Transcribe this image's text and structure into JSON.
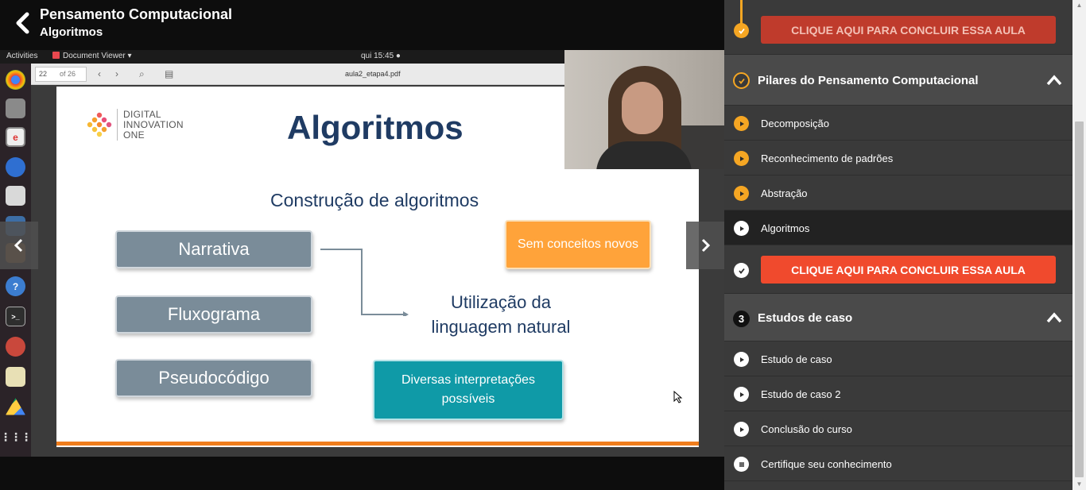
{
  "header": {
    "course_title": "Pensamento Computacional",
    "lesson_title": "Algoritmos"
  },
  "ubuntu": {
    "activities": "Activities",
    "app_name": "Document Viewer ▾",
    "clock": "qui 15:45 ●"
  },
  "pdf": {
    "current_page": "22",
    "page_total": "of 26",
    "file_name": "aula2_etapa4.pdf"
  },
  "slide": {
    "logo_line1": "DIGITAL",
    "logo_line2": "INNOVATION",
    "logo_line3": "ONE",
    "title": "Algoritmos",
    "subtitle": "Construção de algoritmos",
    "box_narrativa": "Narrativa",
    "box_fluxograma": "Fluxograma",
    "box_pseudocodigo": "Pseudocódigo",
    "box_sem_conceitos": "Sem conceitos novos",
    "box_diversas": "Diversas interpretações possíveis",
    "natural_language": "Utilização da linguagem natural"
  },
  "sidebar": {
    "complete_label": "CLIQUE AQUI PARA CONCLUIR ESSA AULA",
    "section2": {
      "title": "Pilares do Pensamento Computacional",
      "lessons": [
        "Decomposição",
        "Reconhecimento de padrões",
        "Abstração",
        "Algoritmos"
      ]
    },
    "section3": {
      "number": "3",
      "title": "Estudos de caso",
      "lessons": [
        "Estudo de caso",
        "Estudo de caso 2",
        "Conclusão do curso",
        "Certifique seu conhecimento"
      ]
    }
  },
  "colors": {
    "accent_orange": "#f5a623",
    "complete_red": "#f04a2d",
    "slide_navy": "#1f3b63"
  }
}
